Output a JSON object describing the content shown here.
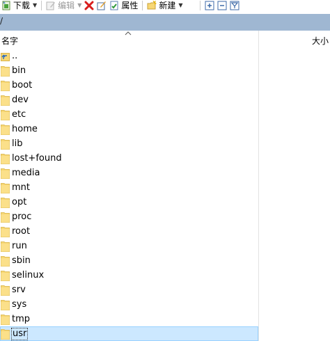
{
  "toolbar": {
    "download": "下载",
    "edit": "编辑",
    "properties": "属性",
    "new": "新建"
  },
  "path": "/",
  "columns": {
    "name": "名字",
    "size": "大小"
  },
  "files": [
    {
      "name": "..",
      "type": "parent"
    },
    {
      "name": "bin",
      "type": "folder"
    },
    {
      "name": "boot",
      "type": "folder"
    },
    {
      "name": "dev",
      "type": "folder"
    },
    {
      "name": "etc",
      "type": "folder"
    },
    {
      "name": "home",
      "type": "folder"
    },
    {
      "name": "lib",
      "type": "folder"
    },
    {
      "name": "lost+found",
      "type": "folder"
    },
    {
      "name": "media",
      "type": "folder"
    },
    {
      "name": "mnt",
      "type": "folder"
    },
    {
      "name": "opt",
      "type": "folder"
    },
    {
      "name": "proc",
      "type": "folder"
    },
    {
      "name": "root",
      "type": "folder"
    },
    {
      "name": "run",
      "type": "folder"
    },
    {
      "name": "sbin",
      "type": "folder"
    },
    {
      "name": "selinux",
      "type": "folder"
    },
    {
      "name": "srv",
      "type": "folder"
    },
    {
      "name": "sys",
      "type": "folder"
    },
    {
      "name": "tmp",
      "type": "folder"
    },
    {
      "name": "usr",
      "type": "folder",
      "selected": true
    }
  ],
  "colors": {
    "pathbar": "#9fb7d2",
    "selection_bg": "#cce8ff",
    "selection_border": "#99d1ff",
    "folder": "#f7d774"
  }
}
